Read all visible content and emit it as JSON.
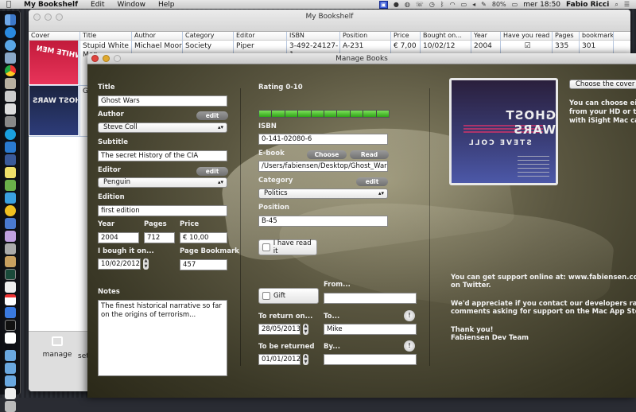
{
  "menubar": {
    "app_name": "My Bookshelf",
    "menus": [
      "Edit",
      "Window",
      "Help"
    ],
    "battery": "80%",
    "clock": "mer 18:50",
    "user": "Fabio Ricci"
  },
  "bookshelf_window": {
    "title": "My Bookshelf",
    "columns": [
      "Cover",
      "Title",
      "Author",
      "Category",
      "Editor",
      "ISBN",
      "Position",
      "Price",
      "Bought on...",
      "Year",
      "Have you read it?",
      "Pages",
      "bookmark"
    ],
    "rows": [
      {
        "title": "Stupid White Men",
        "author": "Michael Moore",
        "category": "Society",
        "editor": "Piper",
        "isbn": "3-492-24127-1",
        "position": "A-231",
        "price": "€ 7,00",
        "bought_on": "10/02/12",
        "year": "2004",
        "read": true,
        "pages": "335",
        "bookmark": "301",
        "cover_text": "STUPID WHITE MEN"
      },
      {
        "title": "Gh",
        "cover_text": "GHOST WARS"
      }
    ],
    "toolbar": {
      "manage_label": "manage",
      "settings_label": "sett"
    }
  },
  "manage_window": {
    "title": "Manage Books",
    "fields": {
      "title_label": "Title",
      "title_value": "Ghost Wars",
      "author_label": "Author",
      "author_value": "Steve Coll",
      "subtitle_label": "Subtitle",
      "subtitle_value": "The secret History of the CIA",
      "editor_label": "Editor",
      "editor_value": "Penguin",
      "edition_label": "Edition",
      "edition_value": "first edition",
      "year_label": "Year",
      "year_value": "2004",
      "pages_label": "Pages",
      "pages_value": "712",
      "price_label": "Price",
      "price_value": "€ 10,00",
      "bought_label": "I bough it on...",
      "bought_value": "10/02/2012",
      "bookmark_label": "Page Bookmark",
      "bookmark_value": "457",
      "notes_label": "Notes",
      "notes_value": "The finest historical narrative so far on the origins of terrorism...",
      "rating_label": "Rating 0-10",
      "rating_value": 10,
      "rating_max": 10,
      "isbn_label": "ISBN",
      "isbn_value": "0-141-02080-6",
      "ebook_label": "E-book",
      "ebook_value": "/Users/fabiensen/Desktop/Ghost_Wars.",
      "category_label": "Category",
      "category_value": "Politics",
      "position_label": "Position",
      "position_value": "B-45",
      "read_label": "I have read it",
      "read_checked": false,
      "gift_label": "Gift",
      "gift_checked": false,
      "from_label": "From...",
      "from_value": "",
      "return_on_label": "To return on...",
      "return_on_value": "28/05/2013",
      "to_label": "To...",
      "to_value": "Mike",
      "to_be_returned_label": "To be returned",
      "to_be_returned_value": "01/01/2012",
      "by_label": "By...",
      "by_value": ""
    },
    "buttons": {
      "edit": "edit",
      "choose": "Choose",
      "read": "Read",
      "choose_cover": "Choose the cover",
      "info": "!"
    },
    "cover_text": {
      "title": "GHOST WARS",
      "author": "STEVE COLL"
    },
    "cover_help": [
      "You can choose eithe",
      "from your HD or take",
      "with iSight Mac came"
    ],
    "support": [
      "You can get support online at: www.fabiensen.com and @fa",
      "on Twitter.",
      "",
      "We'd appreciate if you contact our developers rather than t",
      "comments asking for support on the Mac App Store!",
      "",
      "Thank you!",
      "Fabiensen Dev Team"
    ]
  }
}
